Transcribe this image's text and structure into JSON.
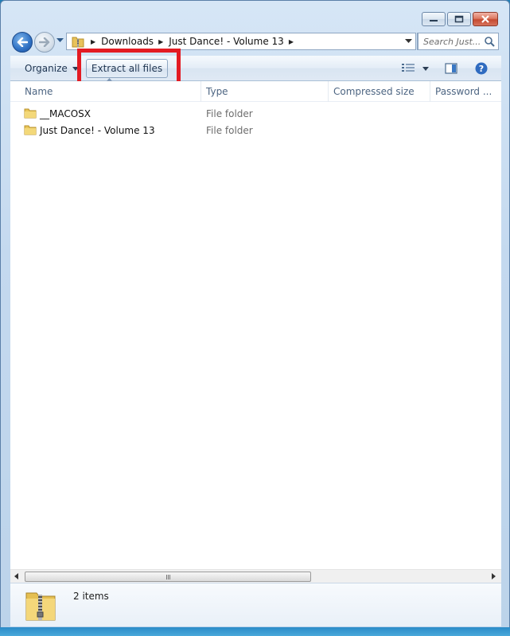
{
  "window": {
    "caption_buttons": [
      "minimize-icon",
      "maximize-icon",
      "close-icon"
    ]
  },
  "navigation": {
    "breadcrumbs": [
      "Downloads",
      "Just Dance! - Volume 13"
    ],
    "search_placeholder": "Search Just..."
  },
  "toolbar": {
    "organize_label": "Organize",
    "extract_label": "Extract all files"
  },
  "columns": {
    "name": "Name",
    "type": "Type",
    "compressed": "Compressed size",
    "password": "Password ..."
  },
  "files": [
    {
      "name": "__MACOSX",
      "type": "File folder"
    },
    {
      "name": "Just Dance! - Volume 13",
      "type": "File folder"
    }
  ],
  "details": {
    "item_count": "2 items"
  },
  "colors": {
    "highlight": "#e31b23",
    "accent": "#2f71c4"
  }
}
